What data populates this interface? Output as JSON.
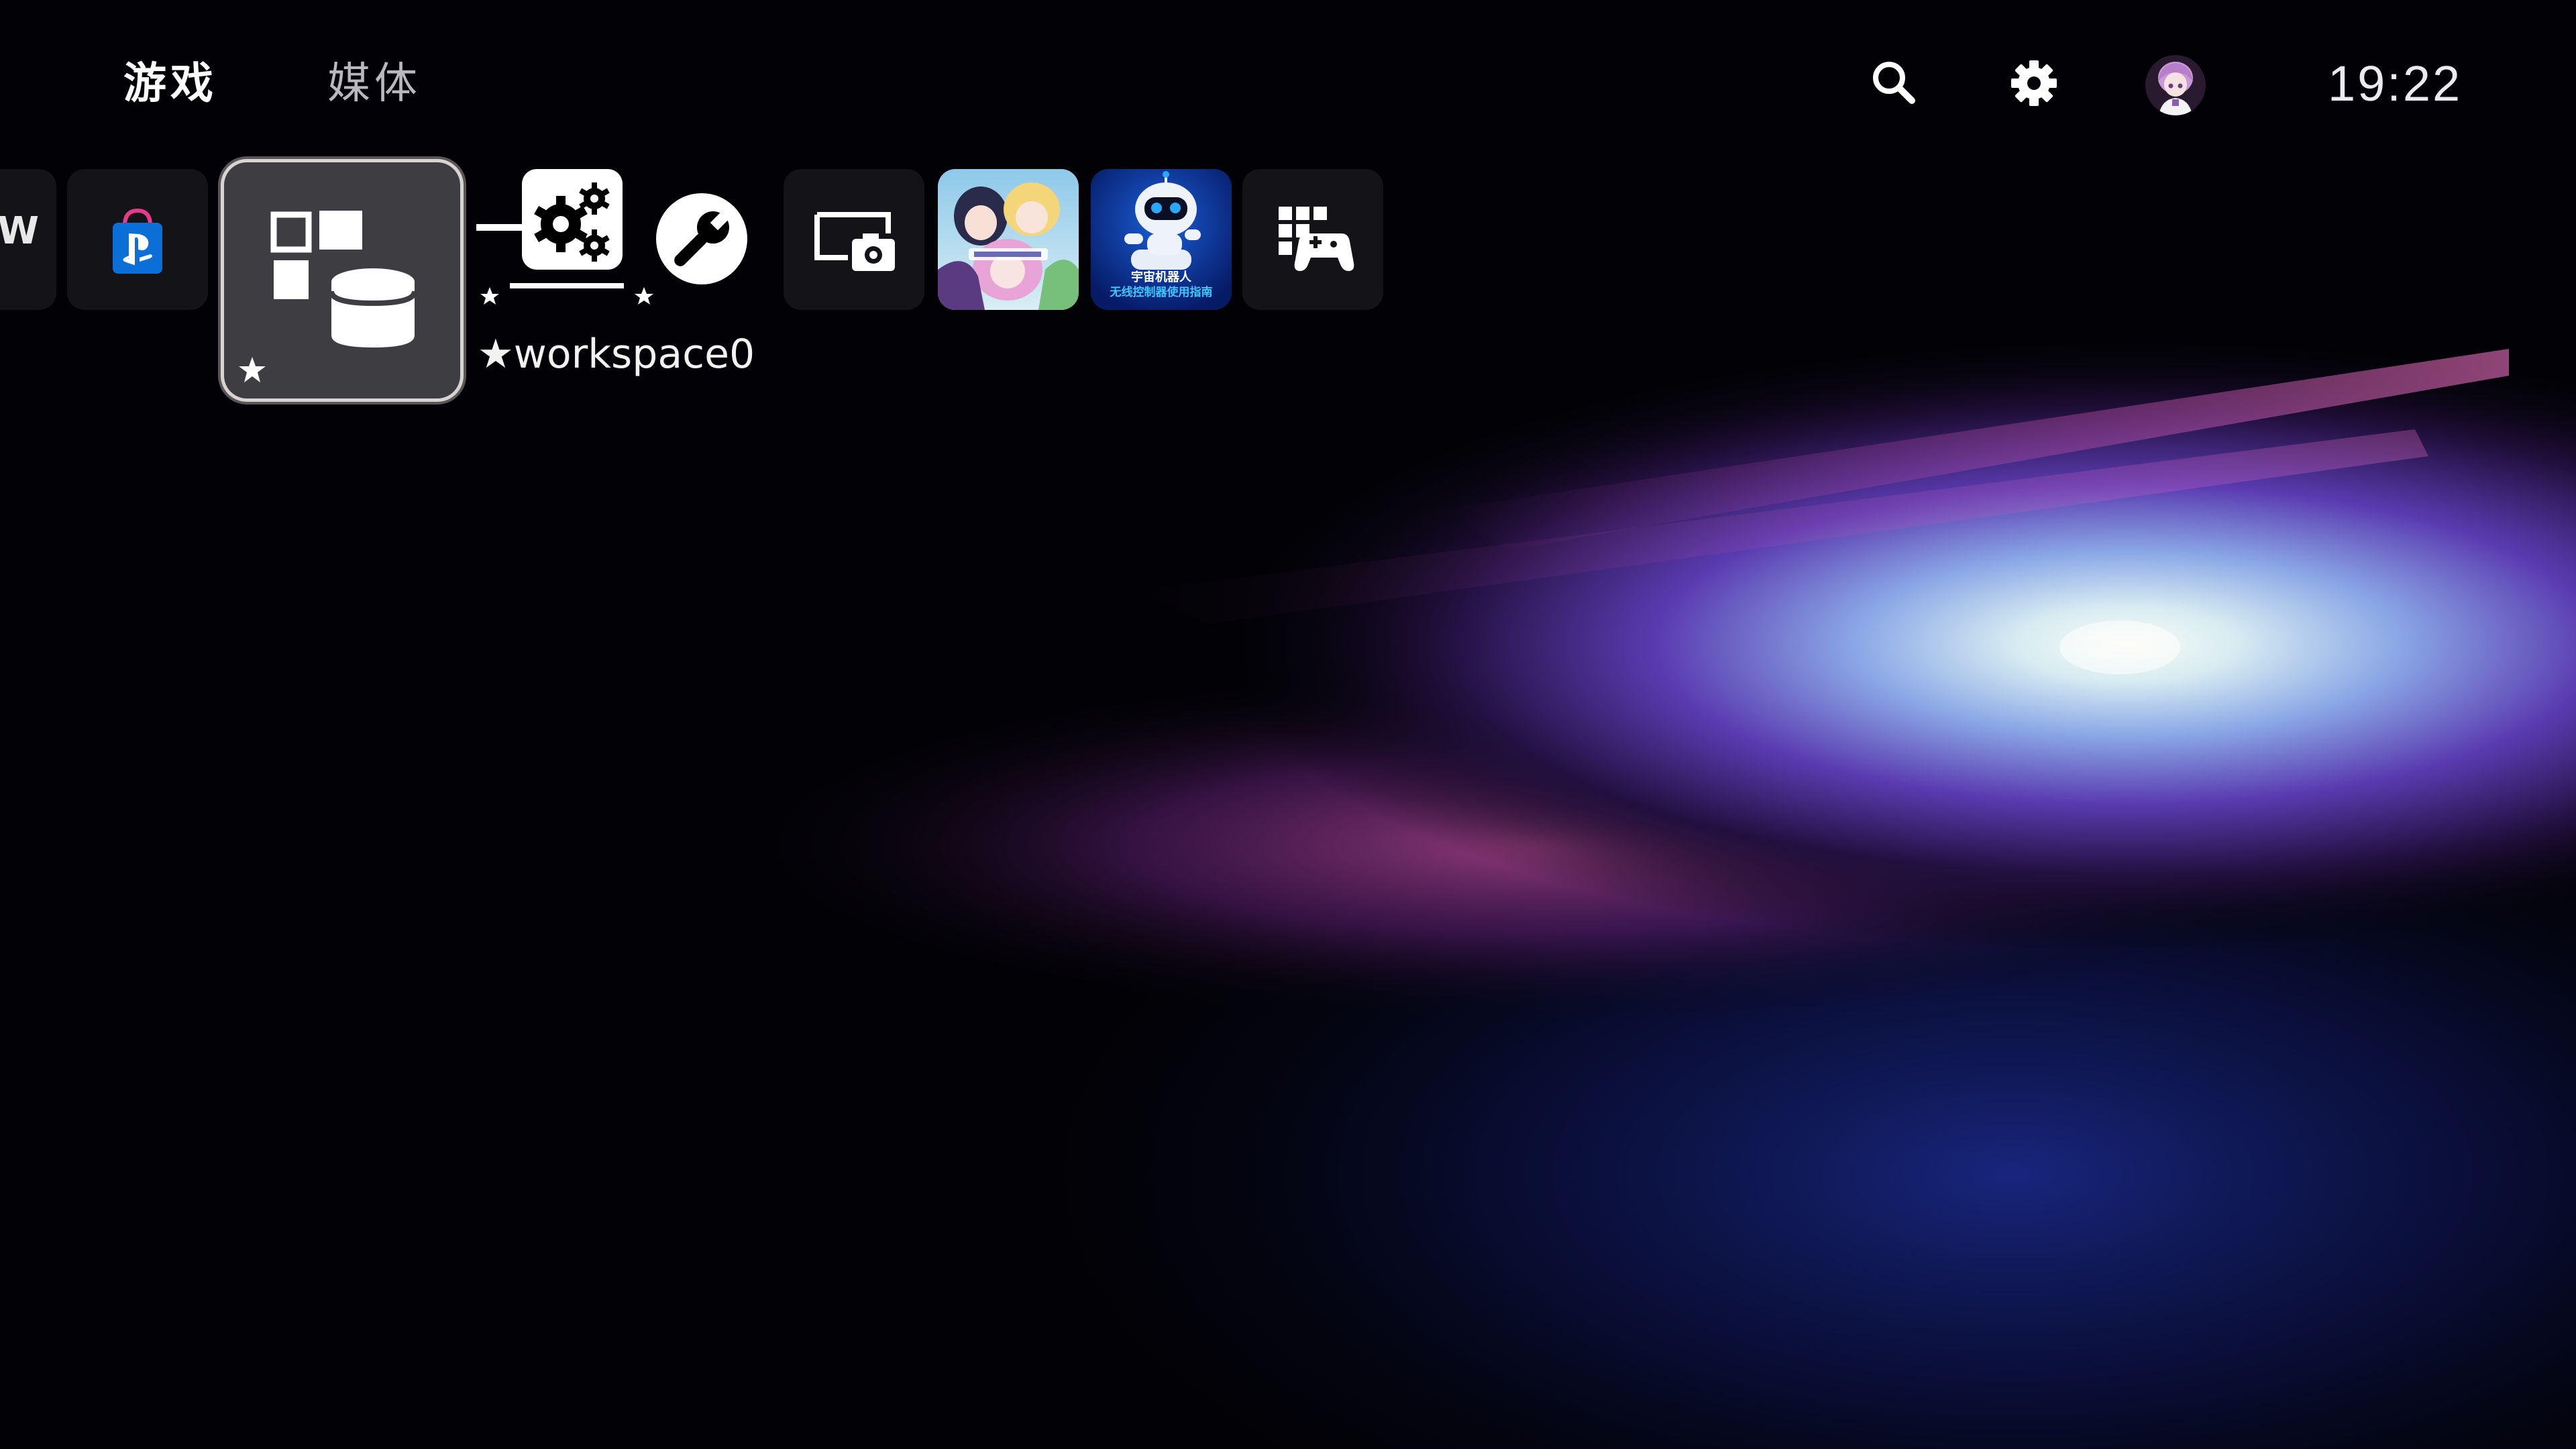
{
  "header": {
    "tabs": [
      {
        "label": "游戏",
        "active": true
      },
      {
        "label": "媒体",
        "active": false
      }
    ],
    "search_icon": "search-icon",
    "settings_icon": "gear-icon",
    "avatar_icon": "user-avatar",
    "clock": "19:22"
  },
  "tiles_row": {
    "partial_tile_text": "W",
    "store_icon": "playstation-store-icon",
    "selected_tile_icon": "widgets-database-icon",
    "selected_label": "★workspace0",
    "items": [
      {
        "icon": "gears-icon",
        "starred": true
      },
      {
        "icon": "wrench-icon",
        "starred": true
      },
      {
        "icon": "screen-capture-icon"
      },
      {
        "icon": "game-cover-anime"
      },
      {
        "icon": "game-cover-astro"
      },
      {
        "icon": "game-library-icon"
      }
    ],
    "game2_cover_lines": [
      "宇宙机器人",
      "无线控制器使用指南"
    ]
  },
  "colors": {
    "accent_blue": "#0a6fd6",
    "selected_tile_bg": "#3e3e42",
    "text_primary": "#ffffff",
    "text_secondary": "#b8b8be"
  }
}
